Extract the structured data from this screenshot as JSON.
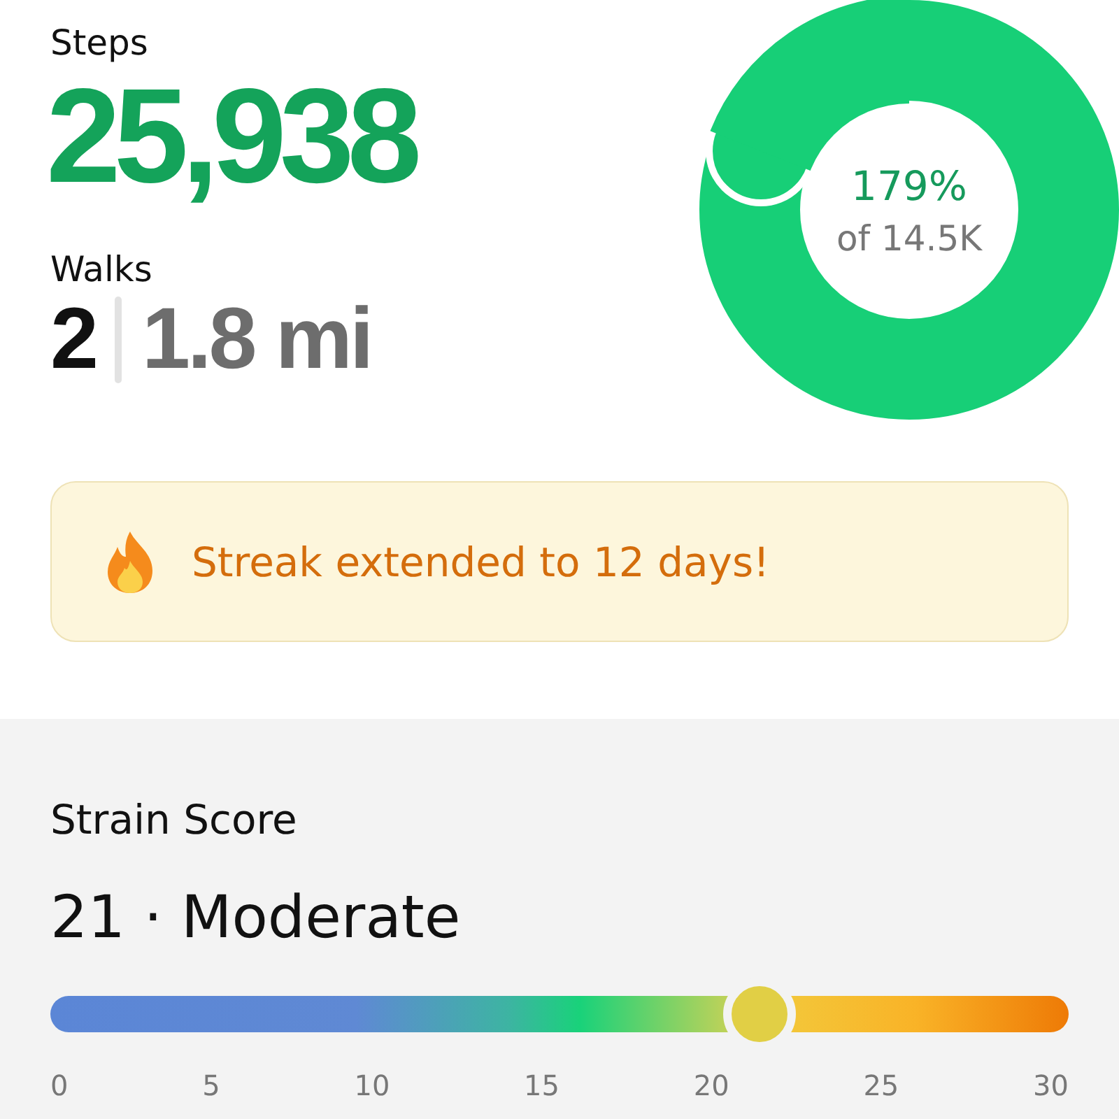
{
  "steps": {
    "label": "Steps",
    "value": "25,938"
  },
  "walks": {
    "label": "Walks",
    "count": "2",
    "distance": "1.8 mi"
  },
  "goal_ring": {
    "percent": "179%",
    "goal": "of 14.5K"
  },
  "streak_banner": {
    "message": "Streak extended to 12 days!"
  },
  "strain": {
    "title": "Strain Score",
    "reading": "21 · Moderate",
    "level": 0.696,
    "ticks": [
      "0",
      "5",
      "10",
      "15",
      "20",
      "25",
      "30"
    ]
  }
}
